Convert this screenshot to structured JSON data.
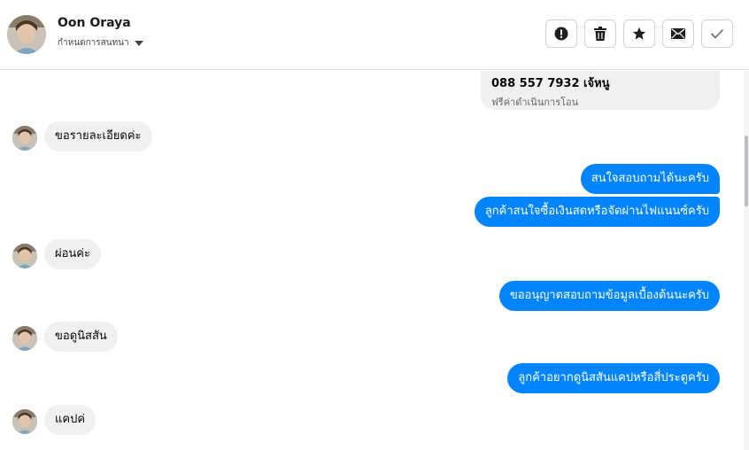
{
  "header": {
    "contact_name": "Oon Oraya",
    "status_label": "กำหนดการสนทนา",
    "actions": [
      {
        "icon": "alert-icon",
        "label": "Mark as spam"
      },
      {
        "icon": "trash-icon",
        "label": "Delete"
      },
      {
        "icon": "star-icon",
        "label": "Star"
      },
      {
        "icon": "mail-icon",
        "label": "Mark unread"
      },
      {
        "icon": "check-icon",
        "label": "Done"
      }
    ]
  },
  "messages": {
    "card": {
      "phone": "088 557 7932 เจ้หนู",
      "sub": "ฟรีค่าดำเนินการโอน"
    },
    "m1": "ขอรายละเอียดค่ะ",
    "m2": "สนใจสอบถามได้นะครับ",
    "m3": "ลูกค้าสนใจซื้อเงินสดหรือจัดผ่านไฟแนนซ์ครับ",
    "m4": "ผ่อนค่ะ",
    "m5": "ขออนุญาตสอบถามข้อมูลเบื้องต้นนะครับ",
    "m6": "ขอดูนิสสัน",
    "m7": "ลูกค้าอยากดูนิสสันแคปหรือสี่ประตูครับ",
    "m8": "แคปค่"
  },
  "colors": {
    "outgoing": "#0084ff",
    "incoming": "#f0f0f0",
    "border": "#dadde1"
  }
}
